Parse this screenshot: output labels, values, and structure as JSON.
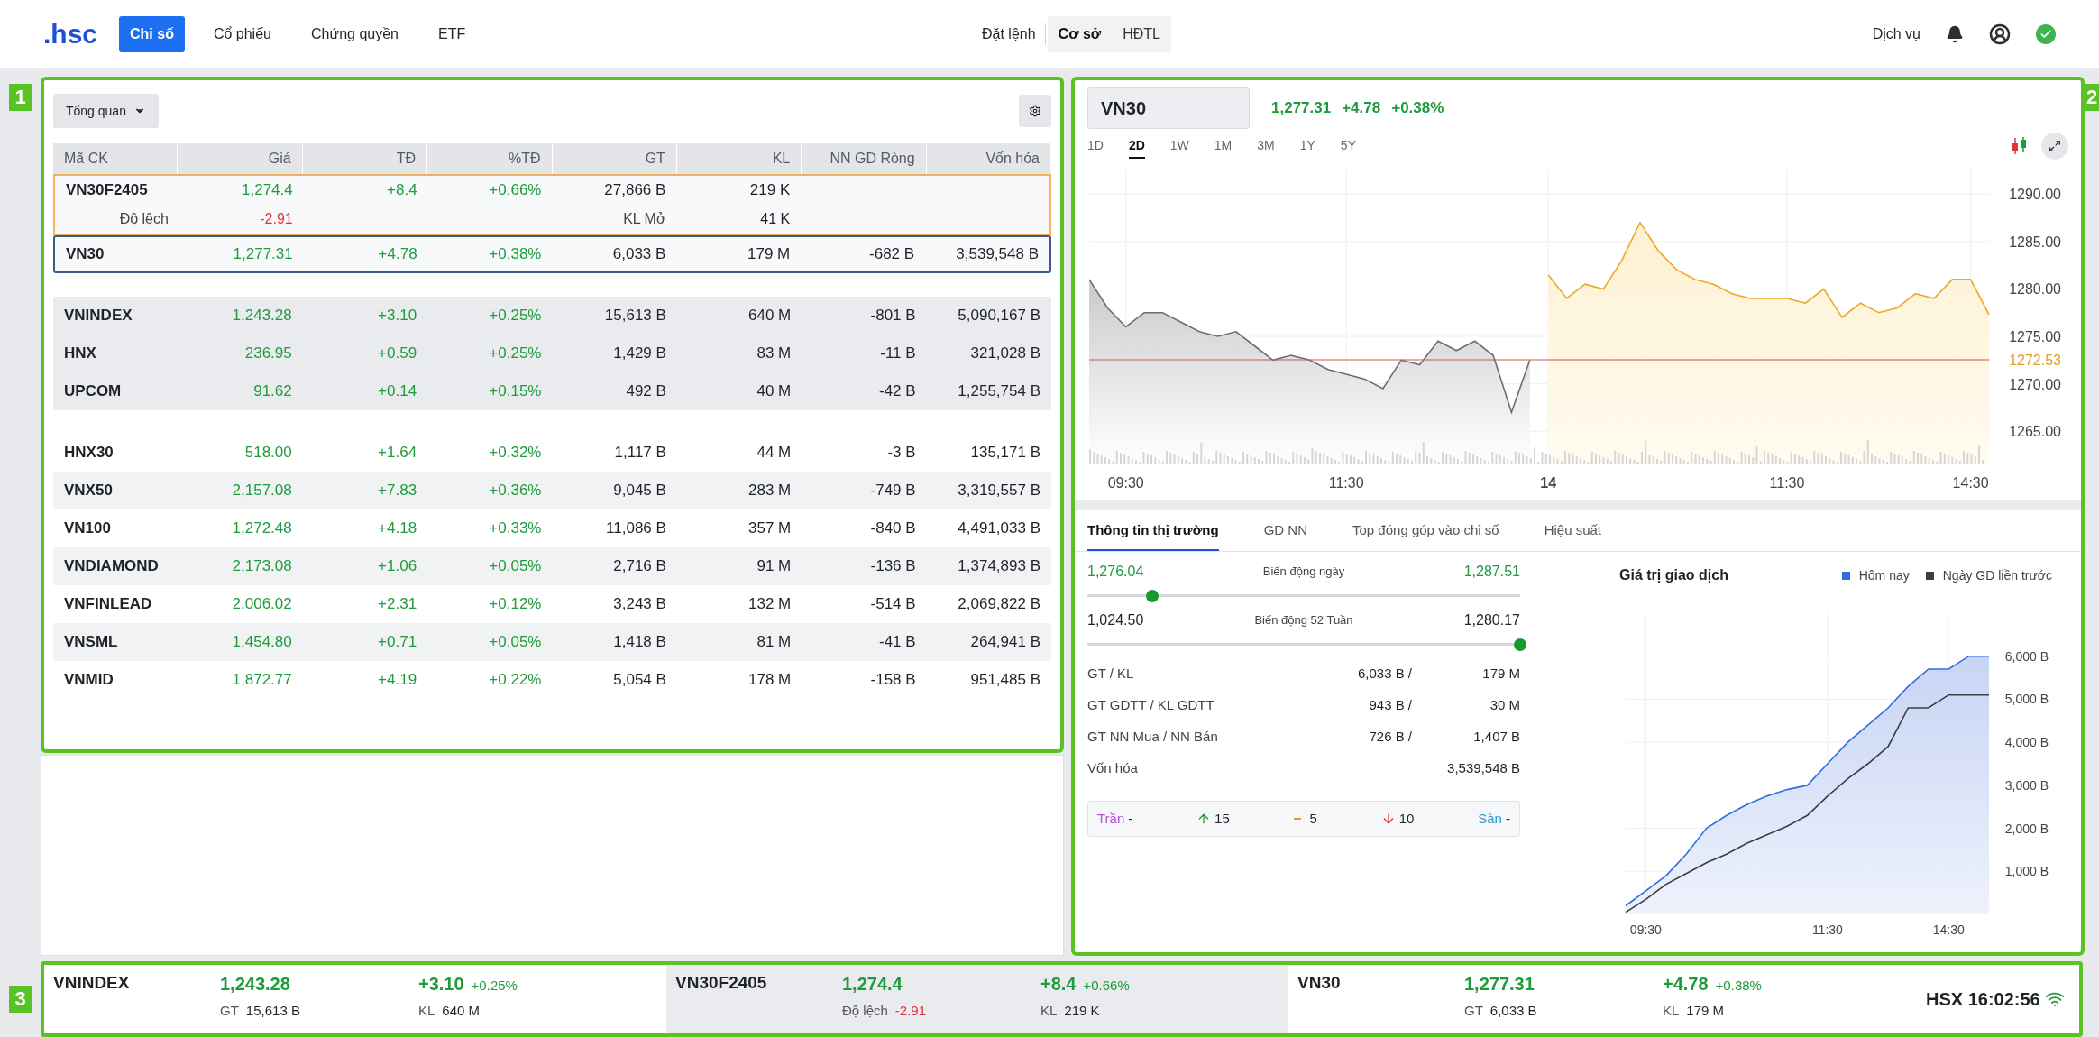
{
  "nav": {
    "logo": ".hsc",
    "tabs": [
      {
        "label": "Chỉ số",
        "selected": true
      },
      {
        "label": "Cổ phiếu",
        "selected": false
      },
      {
        "label": "Chứng quyền",
        "selected": false
      },
      {
        "label": "ETF",
        "selected": false
      }
    ],
    "order": "Đặt lệnh",
    "markets": [
      {
        "label": "Cơ sở",
        "selected": true
      },
      {
        "label": "HĐTL",
        "selected": false
      }
    ],
    "services": "Dịch vụ"
  },
  "callouts": [
    "1",
    "2",
    "3"
  ],
  "overview": {
    "dropdown": "Tổng quan",
    "columns": [
      {
        "label": "Mã CK",
        "kind": "symbol"
      },
      {
        "label": "Giá",
        "kind": "change"
      },
      {
        "label": "TĐ",
        "kind": "change"
      },
      {
        "label": "%TĐ",
        "kind": "change"
      },
      {
        "label": "GT",
        "kind": "num"
      },
      {
        "label": "KL",
        "kind": "num"
      },
      {
        "label": "NN GD Ròng",
        "kind": "num"
      },
      {
        "label": "Vốn hóa",
        "kind": "num"
      }
    ],
    "futures": {
      "cells": [
        "VN30F2405",
        "1,274.4",
        "+8.4",
        "+0.66%",
        "27,866 B",
        "219 K"
      ],
      "basis_label": "Độ lệch",
      "basis_value": "-2.91",
      "oi_label": "KL Mở",
      "oi_value": "41 K"
    },
    "groups": [
      [
        {
          "cells": [
            "VN30",
            "1,277.31",
            "+4.78",
            "+0.38%",
            "6,033 B",
            "179 M",
            "-682 B",
            "3,539,548 B"
          ],
          "selected": true
        }
      ],
      [
        {
          "cells": [
            "VNINDEX",
            "1,243.28",
            "+3.10",
            "+0.25%",
            "15,613 B",
            "640 M",
            "-801 B",
            "5,090,167 B"
          ],
          "selected": false
        },
        {
          "cells": [
            "HNX",
            "236.95",
            "+0.59",
            "+0.25%",
            "1,429 B",
            "83 M",
            "-11 B",
            "321,028 B"
          ],
          "selected": false
        },
        {
          "cells": [
            "UPCOM",
            "91.62",
            "+0.14",
            "+0.15%",
            "492 B",
            "40 M",
            "-42 B",
            "1,255,754 B"
          ],
          "selected": false
        }
      ],
      [
        {
          "cells": [
            "HNX30",
            "518.00",
            "+1.64",
            "+0.32%",
            "1,117 B",
            "44 M",
            "-3 B",
            "135,171 B"
          ],
          "selected": false
        },
        {
          "cells": [
            "VNX50",
            "2,157.08",
            "+7.83",
            "+0.36%",
            "9,045 B",
            "283 M",
            "-749 B",
            "3,319,557 B"
          ],
          "selected": false
        },
        {
          "cells": [
            "VN100",
            "1,272.48",
            "+4.18",
            "+0.33%",
            "11,086 B",
            "357 M",
            "-840 B",
            "4,491,033 B"
          ],
          "selected": false
        },
        {
          "cells": [
            "VNDIAMOND",
            "2,173.08",
            "+1.06",
            "+0.05%",
            "2,716 B",
            "91 M",
            "-136 B",
            "1,374,893 B"
          ],
          "selected": false
        },
        {
          "cells": [
            "VNFINLEAD",
            "2,006.02",
            "+2.31",
            "+0.12%",
            "3,243 B",
            "132 M",
            "-514 B",
            "2,069,822 B"
          ],
          "selected": false
        },
        {
          "cells": [
            "VNSML",
            "1,454.80",
            "+0.71",
            "+0.05%",
            "1,418 B",
            "81 M",
            "-41 B",
            "264,941 B"
          ],
          "selected": false
        },
        {
          "cells": [
            "VNMID",
            "1,872.77",
            "+4.19",
            "+0.22%",
            "5,054 B",
            "178 M",
            "-158 B",
            "951,485 B"
          ],
          "selected": false
        }
      ]
    ]
  },
  "detail": {
    "symbol": "VN30",
    "price": "1,277.31",
    "change": "+4.78",
    "pct": "+0.38%",
    "ranges": [
      {
        "label": "1D",
        "selected": false
      },
      {
        "label": "2D",
        "selected": true
      },
      {
        "label": "1W",
        "selected": false
      },
      {
        "label": "1M",
        "selected": false
      },
      {
        "label": "3M",
        "selected": false
      },
      {
        "label": "1Y",
        "selected": false
      },
      {
        "label": "5Y",
        "selected": false
      }
    ],
    "chart_data": {
      "type": "area",
      "grid": true,
      "categories": [
        null,
        null,
        "09:30",
        null,
        null,
        null,
        null,
        null,
        null,
        null,
        null,
        null,
        null,
        null,
        "11:30",
        null,
        null,
        null,
        null,
        null,
        null,
        null,
        null,
        null,
        null,
        "14",
        null,
        null,
        null,
        null,
        null,
        null,
        null,
        null,
        null,
        null,
        null,
        null,
        "11:30",
        null,
        null,
        null,
        null,
        null,
        null,
        null,
        null,
        null,
        "14:30",
        null
      ],
      "ylim": [
        1261.5,
        1292.5
      ],
      "series": [
        {
          "color": "#6b6e73",
          "values": [
            1281,
            1278,
            1276,
            1277.5,
            1277.5,
            1276.5,
            1275.5,
            1275,
            1275.5,
            1274,
            1272.5,
            1273,
            1272.5,
            1271.5,
            1271,
            1270.5,
            1269.5,
            1272.5,
            1272,
            1274.5,
            1273.5,
            1274.5,
            1273,
            1267,
            1272.5,
            null,
            null,
            null,
            null,
            null,
            null,
            null,
            null,
            null,
            null,
            null,
            null,
            null,
            null,
            null,
            null,
            null,
            null,
            null,
            null,
            null,
            null,
            null,
            null,
            null
          ]
        },
        {
          "color": "#efa724",
          "values": [
            null,
            null,
            null,
            null,
            null,
            null,
            null,
            null,
            null,
            null,
            null,
            null,
            null,
            null,
            null,
            null,
            null,
            null,
            null,
            null,
            null,
            null,
            null,
            null,
            null,
            1281.5,
            1279,
            1280.5,
            1280,
            1283,
            1287,
            1284,
            1282,
            1281,
            1280.5,
            1279.5,
            1279,
            1279,
            1279,
            1278.5,
            1280,
            1277,
            1278.5,
            1277.5,
            1278,
            1279.5,
            1279,
            1281,
            1281,
            1277.3
          ]
        }
      ],
      "yticks": [
        {
          "value": 1265,
          "label": "1265.00"
        },
        {
          "value": 1270,
          "label": "1270.00"
        },
        {
          "value": 1275,
          "label": "1275.00"
        },
        {
          "value": 1280,
          "label": "1280.00"
        },
        {
          "value": 1285,
          "label": "1285.00"
        },
        {
          "value": 1290,
          "label": "1290.00"
        }
      ],
      "ref_lines": [
        {
          "axis": "y",
          "value": 1272.53,
          "label": "1272.53",
          "color": "#d9534f"
        }
      ]
    },
    "tabs": [
      {
        "label": "Thông tin thị trường",
        "selected": true
      },
      {
        "label": "GD NN",
        "selected": false
      },
      {
        "label": "Top đóng góp vào chỉ số",
        "selected": false
      },
      {
        "label": "Hiệu suất",
        "selected": false
      }
    ],
    "ranges_info": [
      {
        "kind": "day",
        "low": "1,276.04",
        "label": "Biến động ngày",
        "high": "1,287.51",
        "level": 0.15
      },
      {
        "kind": "year",
        "low": "1,024.50",
        "label": "Biến động 52 Tuần",
        "high": "1,280.17",
        "level": 1
      }
    ],
    "stats": [
      {
        "label": "GT / KL",
        "value": "6,033 B /",
        "value_2": "179 M"
      },
      {
        "label": "GT GDTT / KL GDTT",
        "value": "943 B /",
        "value_2": "30 M"
      },
      {
        "label": "GT NN Mua / NN Bán",
        "value": "726 B /",
        "value_2": "1,407 B"
      },
      {
        "label": "Vốn hóa",
        "value_2": "3,539,548 B"
      }
    ],
    "breadth": [
      {
        "kind": "ceiling",
        "label": "Trần",
        "value": "-"
      },
      {
        "kind": "up",
        "value": "15"
      },
      {
        "kind": "flat",
        "value": "5"
      },
      {
        "kind": "down",
        "value": "10"
      },
      {
        "kind": "floor",
        "label": "Sàn",
        "value": "-"
      }
    ],
    "value_chart": {
      "chart_data": {
        "type": "area",
        "title": "Giá trị giao dịch",
        "grid": true,
        "legend": "upper right",
        "categories": [
          null,
          "09:30",
          null,
          null,
          null,
          null,
          null,
          null,
          null,
          null,
          "11:30",
          null,
          null,
          null,
          null,
          null,
          "14:30",
          null,
          null
        ],
        "ylim": [
          0,
          7000
        ],
        "series": [
          {
            "name": "Hôm nay",
            "color": "#2f6fe0",
            "values": [
              200,
              550,
              900,
              1400,
              2000,
              2300,
              2550,
              2750,
              2900,
              3000,
              3500,
              4000,
              4400,
              4800,
              5300,
              5700,
              5700,
              6000,
              6000
            ]
          },
          {
            "name": "Ngày GD liền trước",
            "type": "line",
            "color": "#3a3d42",
            "values": [
              50,
              350,
              700,
              950,
              1200,
              1400,
              1650,
              1850,
              2050,
              2300,
              2750,
              3150,
              3500,
              3900,
              4800,
              4800,
              5100,
              5100,
              5100
            ]
          }
        ],
        "yticks": [
          {
            "value": 1000,
            "label": "1,000 B"
          },
          {
            "value": 2000,
            "label": "2,000 B"
          },
          {
            "value": 3000,
            "label": "3,000 B"
          },
          {
            "value": 4000,
            "label": "4,000 B"
          },
          {
            "value": 5000,
            "label": "5,000 B"
          },
          {
            "value": 6000,
            "label": "6,000 B"
          }
        ]
      }
    }
  },
  "ticker": [
    {
      "name": "VNINDEX",
      "price": "1,243.28",
      "change": "+3.10",
      "pct": "+0.25%",
      "selected": false,
      "sub": [
        {
          "kind": "plain",
          "label": "GT",
          "value": "15,613 B"
        },
        {
          "kind": "plain",
          "label": "KL",
          "value": "640 M"
        }
      ]
    },
    {
      "name": "VN30F2405",
      "price": "1,274.4",
      "change": "+8.4",
      "pct": "+0.66%",
      "selected": true,
      "sub": [
        {
          "kind": "basis",
          "label": "Độ lệch",
          "value": "-2.91"
        },
        {
          "kind": "plain",
          "label": "KL",
          "value": "219 K"
        }
      ]
    },
    {
      "name": "VN30",
      "price": "1,277.31",
      "change": "+4.78",
      "pct": "+0.38%",
      "selected": false,
      "sub": [
        {
          "kind": "plain",
          "label": "GT",
          "value": "6,033 B"
        },
        {
          "kind": "plain",
          "label": "KL",
          "value": "179 M"
        }
      ]
    }
  ],
  "clock": "HSX 16:02:56"
}
